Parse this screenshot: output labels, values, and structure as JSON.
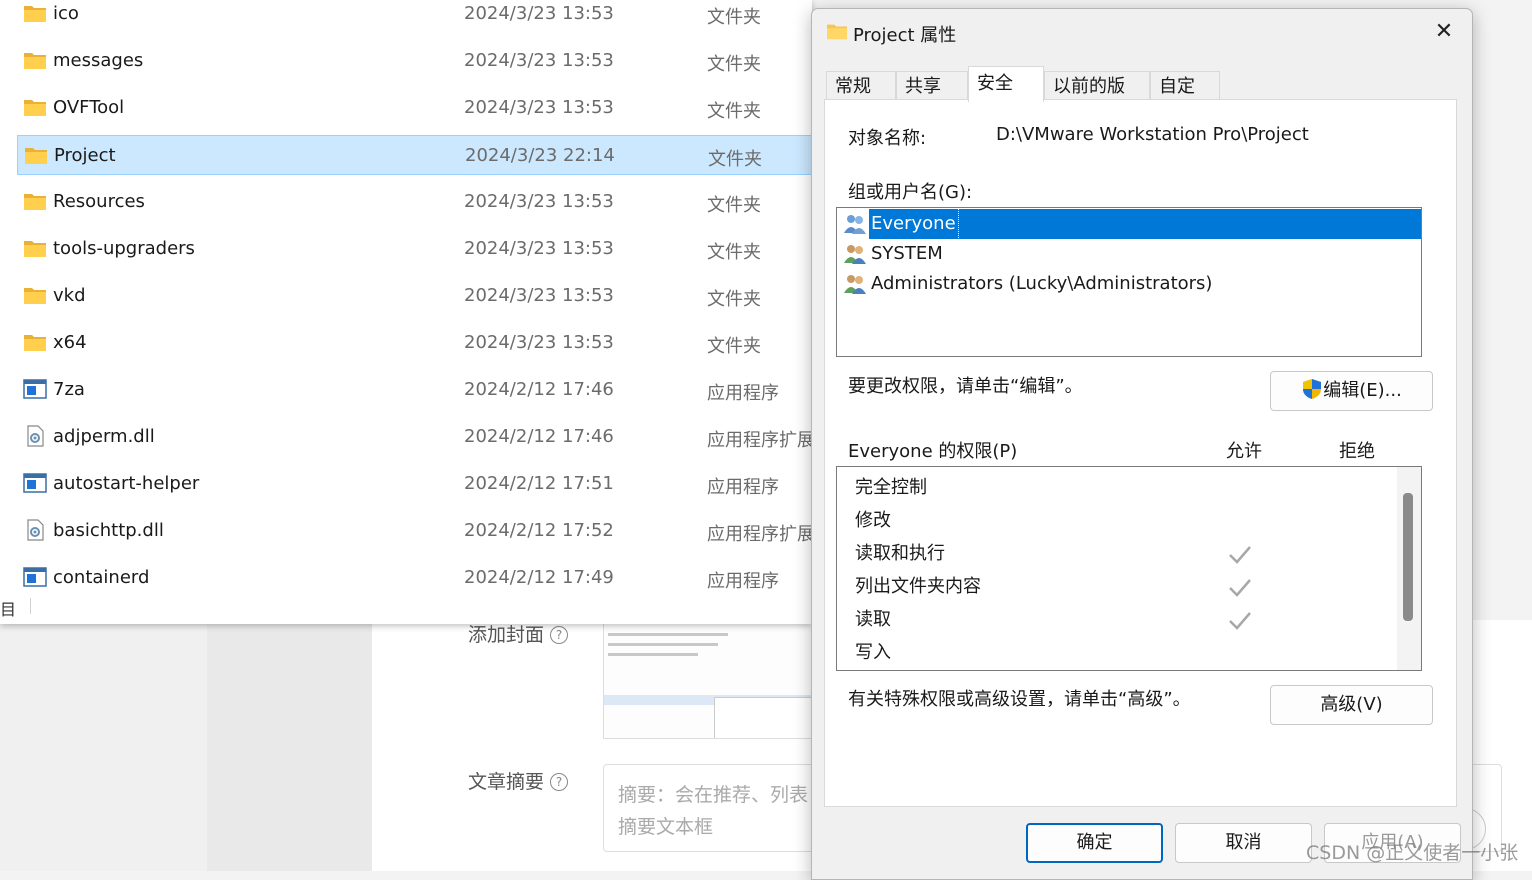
{
  "background_editor": {
    "cover_label": "添加封面",
    "summary_label": "文章摘要",
    "summary_placeholder_line1": "摘要：会在推荐、列表",
    "summary_placeholder_line2": "摘要文本框",
    "help_glyph": "?"
  },
  "explorer": {
    "rows": [
      {
        "name": "ico",
        "date": "2024/3/23 13:53",
        "type": "文件夹",
        "icon": "folder-icon"
      },
      {
        "name": "messages",
        "date": "2024/3/23 13:53",
        "type": "文件夹",
        "icon": "folder-icon"
      },
      {
        "name": "OVFTool",
        "date": "2024/3/23 13:53",
        "type": "文件夹",
        "icon": "folder-icon"
      },
      {
        "name": "Project",
        "date": "2024/3/23 22:14",
        "type": "文件夹",
        "icon": "folder-icon",
        "selected": true
      },
      {
        "name": "Resources",
        "date": "2024/3/23 13:53",
        "type": "文件夹",
        "icon": "folder-icon"
      },
      {
        "name": "tools-upgraders",
        "date": "2024/3/23 13:53",
        "type": "文件夹",
        "icon": "folder-icon"
      },
      {
        "name": "vkd",
        "date": "2024/3/23 13:53",
        "type": "文件夹",
        "icon": "folder-icon"
      },
      {
        "name": "x64",
        "date": "2024/3/23 13:53",
        "type": "文件夹",
        "icon": "folder-icon"
      },
      {
        "name": "7za",
        "date": "2024/2/12 17:46",
        "type": "应用程序",
        "icon": "application-icon"
      },
      {
        "name": "adjperm.dll",
        "date": "2024/2/12 17:46",
        "type": "应用程序扩展",
        "icon": "dll-file-icon"
      },
      {
        "name": "autostart-helper",
        "date": "2024/2/12 17:51",
        "type": "应用程序",
        "icon": "application-icon"
      },
      {
        "name": "basichttp.dll",
        "date": "2024/2/12 17:52",
        "type": "应用程序扩展",
        "icon": "dll-file-icon"
      },
      {
        "name": "containerd",
        "date": "2024/2/12 17:49",
        "type": "应用程序",
        "icon": "application-icon"
      }
    ],
    "status_left": "目"
  },
  "dialog": {
    "title": "Project 属性",
    "close_glyph": "✕",
    "tabs": [
      {
        "label": "常规",
        "active": false
      },
      {
        "label": "共享",
        "active": false
      },
      {
        "label": "安全",
        "active": true
      },
      {
        "label": "以前的版本",
        "active": false
      },
      {
        "label": "自定义",
        "active": false
      }
    ],
    "object_name_label": "对象名称:",
    "object_name_value": "D:\\VMware Workstation Pro\\Project",
    "groups_label": "组或用户名(G):",
    "users": [
      {
        "name": "Everyone",
        "selected": true
      },
      {
        "name": "SYSTEM",
        "selected": false
      },
      {
        "name": "Administrators (Lucky\\Administrators)",
        "selected": false
      }
    ],
    "edit_hint": "要更改权限，请单击“编辑”。",
    "edit_button": "编辑(E)...",
    "permissions_label": "Everyone 的权限(P)",
    "allow_header": "允许",
    "deny_header": "拒绝",
    "permissions": [
      {
        "name": "完全控制",
        "allow": false
      },
      {
        "name": "修改",
        "allow": false
      },
      {
        "name": "读取和执行",
        "allow": true
      },
      {
        "name": "列出文件夹内容",
        "allow": true
      },
      {
        "name": "读取",
        "allow": true
      },
      {
        "name": "写入",
        "allow": false
      }
    ],
    "advanced_hint": "有关特殊权限或高级设置，请单击“高级”。",
    "advanced_button": "高级(V)",
    "ok_button": "确定",
    "cancel_button": "取消",
    "apply_button": "应用(A)"
  },
  "watermark": "CSDN @正义使者一小张",
  "colors": {
    "selection_blue": "#0078d7",
    "explorer_selected": "#cce8ff",
    "folder_yellow": "#f8c64a"
  }
}
